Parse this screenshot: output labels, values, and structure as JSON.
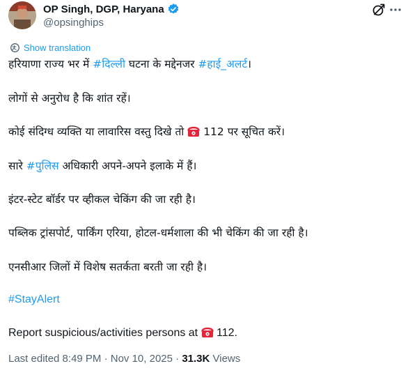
{
  "author": {
    "name": "OP Singh, DGP, Haryana",
    "handle": "@opsinghips"
  },
  "icons": {
    "verified": "verified-badge-icon",
    "grok": "grok-icon",
    "more": "more-options-icon",
    "translate": "translate-icon",
    "phone": "telephone-emoji-icon"
  },
  "colors": {
    "link": "#1d9bf0",
    "text": "#0f1419",
    "muted": "#536471",
    "phone_emoji": "#e0263b"
  },
  "translate_label": "Show translation",
  "paragraphs": {
    "p1": {
      "t1": "हरियाणा राज्य भर में ",
      "tag1": "#दिल्ली",
      "t2": " घटना के मद्देनजर ",
      "tag2": "#हाई_अलर्ट",
      "t3": "।"
    },
    "p2": "लोगों से अनुरोध है कि शांत रहें।",
    "p3": {
      "t1": "कोई संदिग्ध व्यक्ति या लावारिस वस्तु दिखे तो ",
      "t2": " 112 पर सूचित करें।"
    },
    "p4": {
      "t1": "सारे ",
      "tag": "#पुलिस",
      "t2": " अधिकारी अपने-अपने इलाके में हैं।"
    },
    "p5": "इंटर-स्टेट बॉर्डर पर व्हीकल चेकिंग की जा रही है।",
    "p6": "पब्लिक ट्रांसपोर्ट, पार्किंग एरिया, होटल-धर्मशाला की भी चेकिंग की जा रही है।",
    "p7": "एनसीआर जिलों में विशेष सतर्कता बरती जा रही है।",
    "p8": "#StayAlert",
    "p9": {
      "t1": "Report suspicious/activities persons at ",
      "t2": " 112."
    }
  },
  "meta": {
    "edited": "Last edited 8:49 PM · Nov 10, 2025 · ",
    "views_count": "31.3K",
    "views_label": " Views"
  }
}
